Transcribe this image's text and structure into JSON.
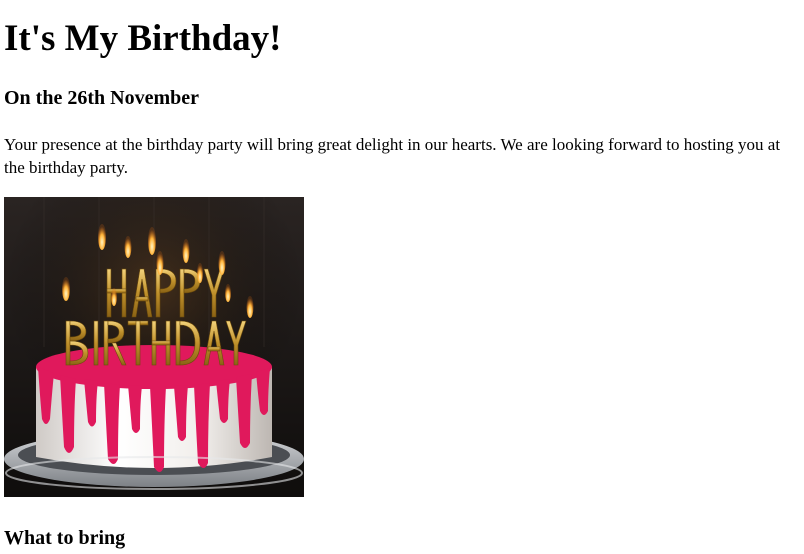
{
  "heading": "It's My Birthday!",
  "date_heading": "On the 26th November",
  "invite_text": "Your presence at the birthday party will bring great delight in our hearts. We are looking forward to hosting you at the birthday party.",
  "image": {
    "cake_topper_text": "HAPPY BIRTHDAY",
    "colors": {
      "background": "#1b1716",
      "frosting": "#f2f0ee",
      "drip": "#e0195c",
      "plate": "#b9bcc0",
      "candle_gold": "#c9962a",
      "flame": "#ffb43a"
    }
  },
  "what_to_bring_heading": "What to bring"
}
